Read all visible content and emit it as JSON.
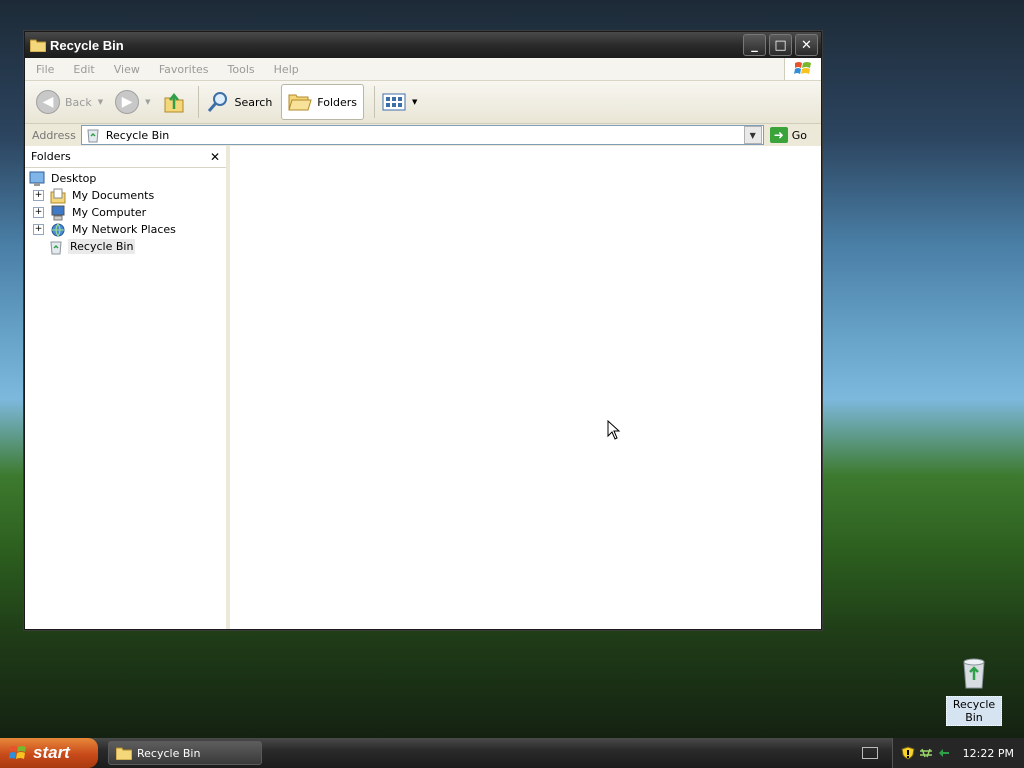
{
  "window": {
    "title": "Recycle Bin",
    "controls": {
      "minimize": "_",
      "maximize": "□",
      "close": "✕"
    }
  },
  "menu": [
    "File",
    "Edit",
    "View",
    "Favorites",
    "Tools",
    "Help"
  ],
  "toolbar": {
    "back_label": "Back",
    "search_label": "Search",
    "folders_label": "Folders"
  },
  "address": {
    "label": "Address",
    "value": "Recycle Bin",
    "go_label": "Go"
  },
  "folders_pane": {
    "title": "Folders",
    "close": "✕",
    "tree": [
      {
        "label": "Desktop",
        "icon": "desktop-icon",
        "expandable": false,
        "level": 0
      },
      {
        "label": "My Documents",
        "icon": "documents-icon",
        "expandable": true,
        "level": 1
      },
      {
        "label": "My Computer",
        "icon": "computer-icon",
        "expandable": true,
        "level": 1
      },
      {
        "label": "My Network Places",
        "icon": "network-icon",
        "expandable": true,
        "level": 1
      },
      {
        "label": "Recycle Bin",
        "icon": "recycle-bin-icon",
        "expandable": false,
        "level": 1,
        "selected": true
      }
    ]
  },
  "desktop": {
    "icon_label": "Recycle Bin"
  },
  "taskbar": {
    "start_label": "start",
    "task_label": "Recycle Bin",
    "clock": "12:22 PM"
  }
}
